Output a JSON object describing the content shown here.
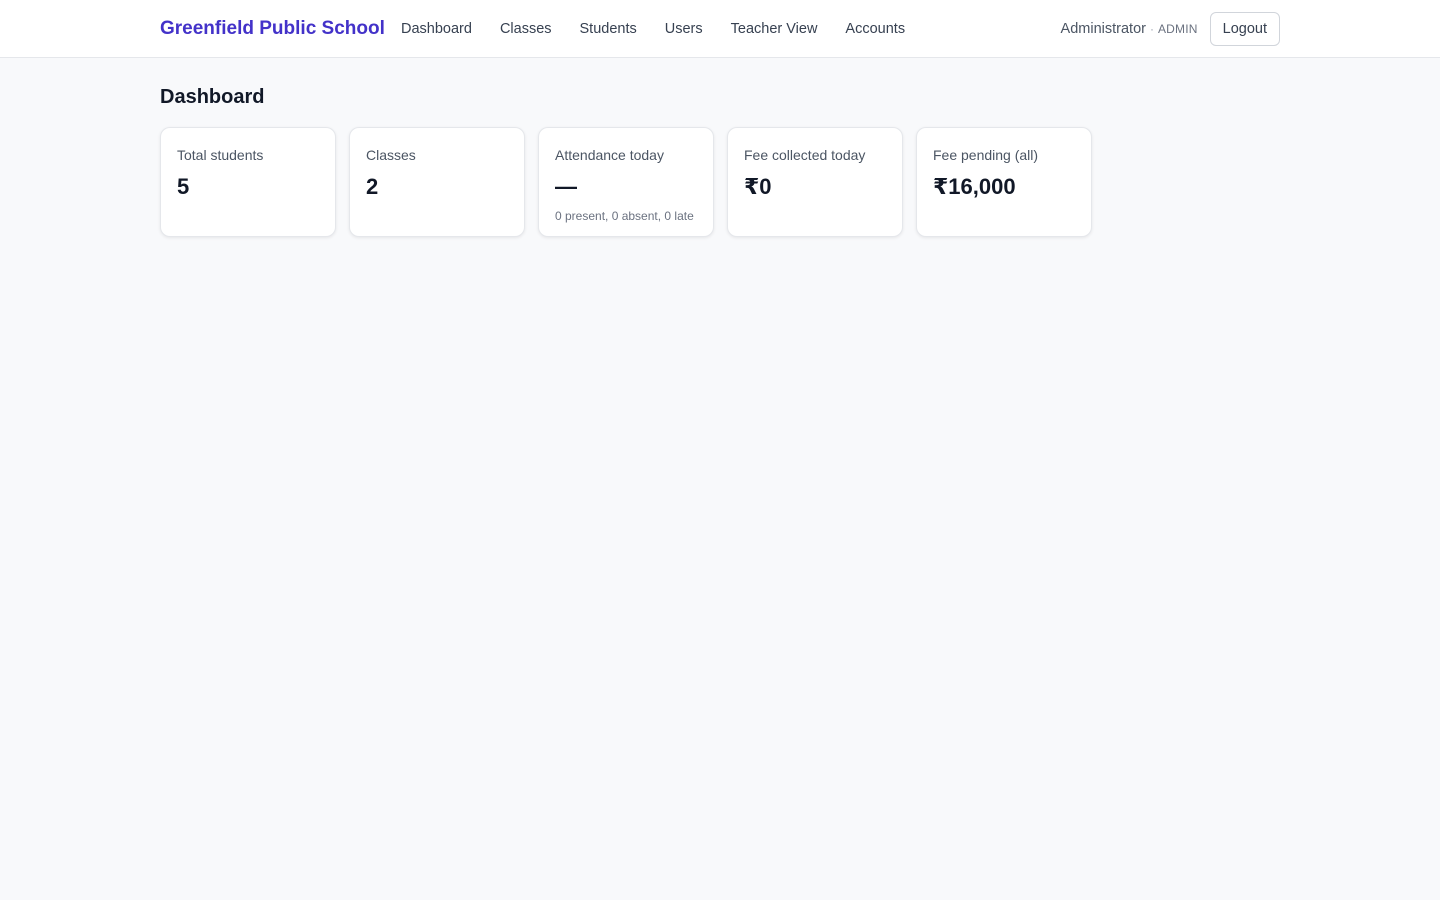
{
  "header": {
    "brand": "Greenfield Public School",
    "nav": [
      {
        "label": "Dashboard"
      },
      {
        "label": "Classes"
      },
      {
        "label": "Students"
      },
      {
        "label": "Users"
      },
      {
        "label": "Teacher View"
      },
      {
        "label": "Accounts"
      }
    ],
    "user": {
      "name": "Administrator",
      "separator": "·",
      "role": "ADMIN"
    },
    "logout_label": "Logout"
  },
  "main": {
    "title": "Dashboard",
    "cards": [
      {
        "label": "Total students",
        "value": "5",
        "sub": ""
      },
      {
        "label": "Classes",
        "value": "2",
        "sub": ""
      },
      {
        "label": "Attendance today",
        "value": "—",
        "sub": "0 present, 0 absent, 0 late"
      },
      {
        "label": "Fee collected today",
        "value": "₹0",
        "sub": ""
      },
      {
        "label": "Fee pending (all)",
        "value": "₹16,000",
        "sub": ""
      }
    ]
  },
  "colors": {
    "brand": "#4332c9",
    "background": "#f8f9fb",
    "card_background": "#ffffff",
    "text_primary": "#111827",
    "text_muted": "#6b7280"
  }
}
